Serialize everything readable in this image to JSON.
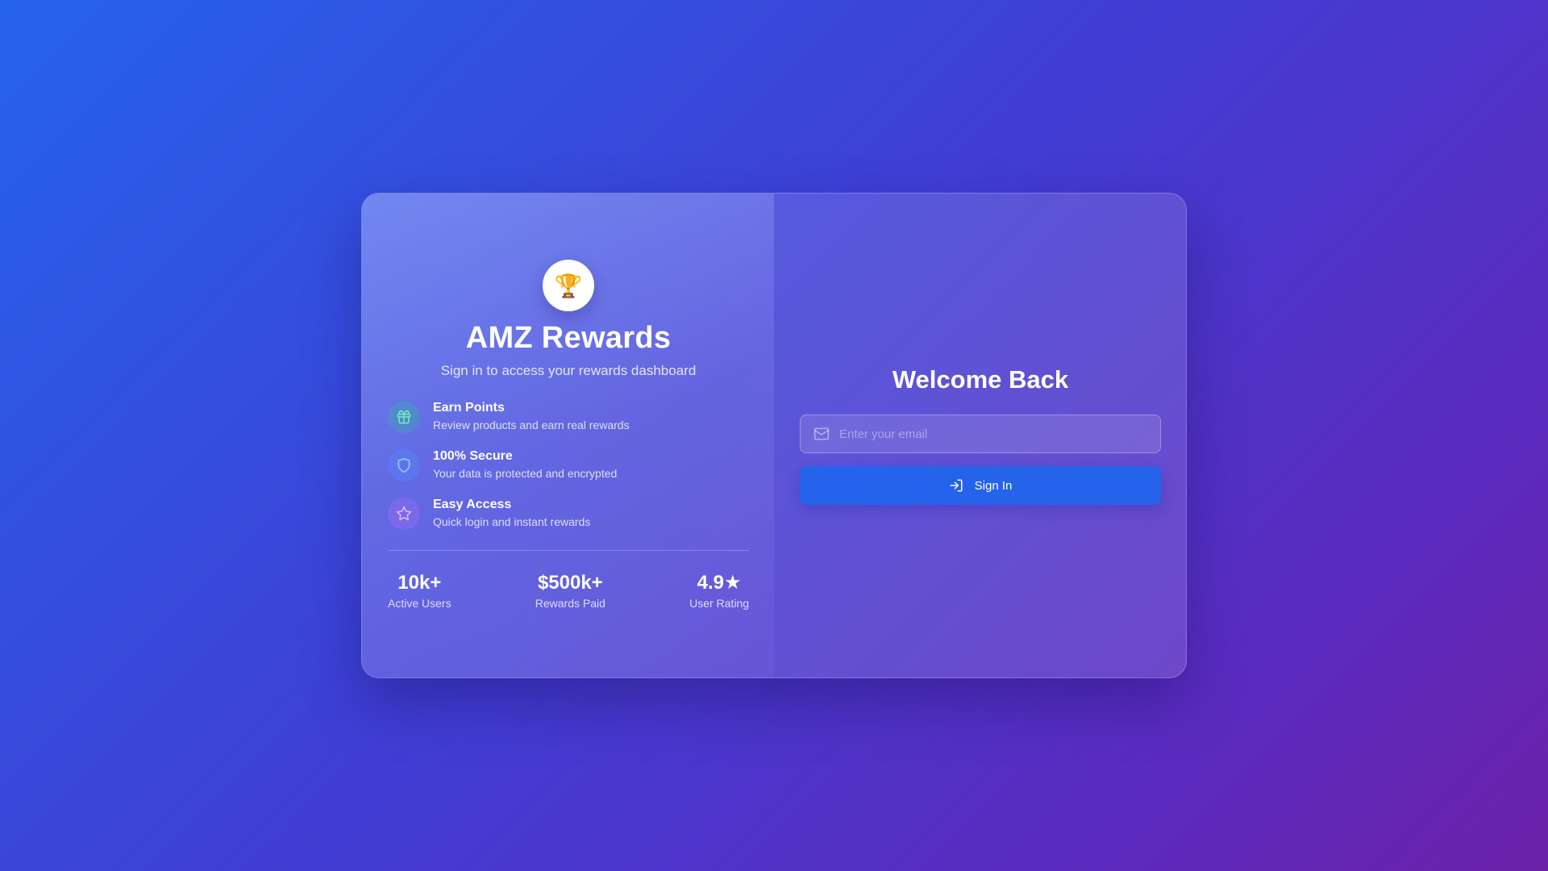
{
  "brand": {
    "logo_icon": "trophy-icon",
    "logo_glyph": "🏆",
    "title": "AMZ Rewards",
    "subtitle": "Sign in to access your rewards dashboard"
  },
  "features": [
    {
      "icon": "gift-icon",
      "title": "Earn Points",
      "description": "Review products and earn real rewards",
      "icon_color": "#6ee7b7"
    },
    {
      "icon": "shield-icon",
      "title": "100% Secure",
      "description": "Your data is protected and encrypted",
      "icon_color": "#93c5fd"
    },
    {
      "icon": "star-icon",
      "title": "Easy Access",
      "description": "Quick login and instant rewards",
      "icon_color": "#d8b4fe"
    }
  ],
  "stats": [
    {
      "value": "10k+",
      "label": "Active Users"
    },
    {
      "value": "$500k+",
      "label": "Rewards Paid"
    },
    {
      "value": "4.9★",
      "label": "User Rating"
    }
  ],
  "login": {
    "heading": "Welcome Back",
    "email_placeholder": "Enter your email",
    "email_value": "",
    "email_icon": "mail-icon",
    "signin_label": "Sign In",
    "signin_icon": "log-in-icon"
  },
  "colors": {
    "accent": "#2563eb",
    "background_start": "#2563eb",
    "background_end": "#6b21a8"
  }
}
